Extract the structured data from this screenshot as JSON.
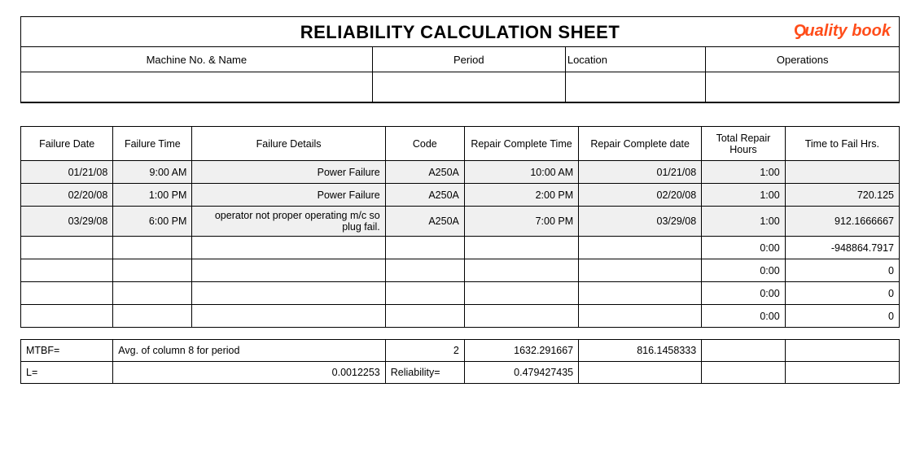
{
  "title": "RELIABILITY CALCULATION SHEET",
  "logo_text": "uality book",
  "header": {
    "cols": [
      "Machine No. & Name",
      "Period",
      "Location",
      "Operations"
    ],
    "vals": [
      "",
      "",
      "",
      ""
    ]
  },
  "table": {
    "headers": [
      "Failure Date",
      "Failure Time",
      "Failure Details",
      "Code",
      "Repair Complete Time",
      "Repair Complete date",
      "Total Repair Hours",
      "Time to Fail Hrs."
    ],
    "rows": [
      {
        "fdate": "01/21/08",
        "ftime": "9:00 AM",
        "details": "Power Failure",
        "code": "A250A",
        "rtime": "10:00 AM",
        "rdate": "01/21/08",
        "trh": "1:00",
        "ttf": ""
      },
      {
        "fdate": "02/20/08",
        "ftime": "1:00 PM",
        "details": "Power Failure",
        "code": "A250A",
        "rtime": "2:00 PM",
        "rdate": "02/20/08",
        "trh": "1:00",
        "ttf": "720.125"
      },
      {
        "fdate": "03/29/08",
        "ftime": "6:00 PM",
        "details": "operator not proper operating m/c so plug fail.",
        "code": "A250A",
        "rtime": "7:00 PM",
        "rdate": "03/29/08",
        "trh": "1:00",
        "ttf": "912.1666667"
      },
      {
        "fdate": "",
        "ftime": "",
        "details": "",
        "code": "",
        "rtime": "",
        "rdate": "",
        "trh": "0:00",
        "ttf": "-948864.7917"
      },
      {
        "fdate": "",
        "ftime": "",
        "details": "",
        "code": "",
        "rtime": "",
        "rdate": "",
        "trh": "0:00",
        "ttf": "0"
      },
      {
        "fdate": "",
        "ftime": "",
        "details": "",
        "code": "",
        "rtime": "",
        "rdate": "",
        "trh": "0:00",
        "ttf": "0"
      },
      {
        "fdate": "",
        "ftime": "",
        "details": "",
        "code": "",
        "rtime": "",
        "rdate": "",
        "trh": "0:00",
        "ttf": "0"
      }
    ]
  },
  "summary": {
    "r1": {
      "c0": "MTBF=",
      "c1": "Avg. of column 8 for period",
      "c2": "2",
      "c3": "1632.291667",
      "c4": "816.1458333",
      "c5": "",
      "c6": ""
    },
    "r2": {
      "c0": "L=",
      "c1": "0.0012253",
      "c2": "Reliability=",
      "c3": "0.479427435",
      "c4": "",
      "c5": "",
      "c6": ""
    }
  }
}
